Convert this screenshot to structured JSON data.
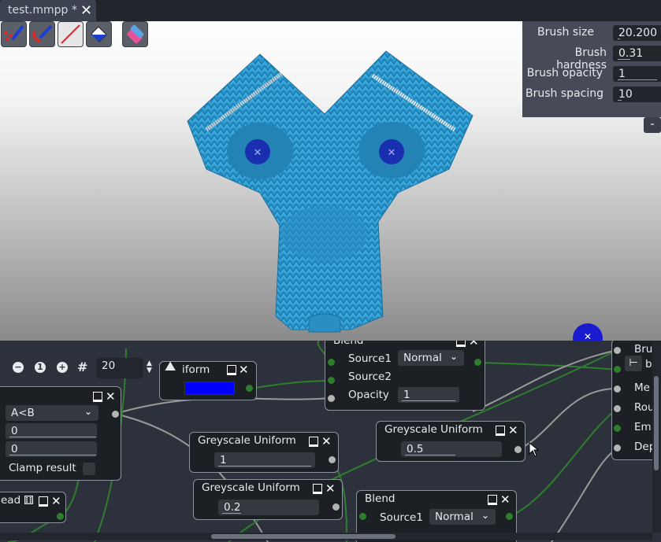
{
  "tab": {
    "title": "test.mmpp *",
    "close_icon": "close-icon"
  },
  "toolbar": {
    "tools": [
      {
        "name": "brush-dots-tool",
        "icon": "brush-dots-icon"
      },
      {
        "name": "brush-stroke-tool",
        "icon": "brush-stroke-icon"
      },
      {
        "name": "line-tool",
        "icon": "line-icon"
      },
      {
        "name": "fill-tool",
        "icon": "bucket-fill-icon"
      },
      {
        "name": "eraser-tool",
        "icon": "eraser-icon"
      }
    ]
  },
  "brush_params": {
    "rows": [
      {
        "label": "Brush size",
        "value": "20.200",
        "fill": 0.06
      },
      {
        "label": "Brush hardness",
        "value": "0.31",
        "fill": 0.31
      },
      {
        "label": "Brush opacity",
        "value": "1",
        "fill": 1.0
      },
      {
        "label": "Brush spacing",
        "value": "10",
        "fill": 0.1
      }
    ],
    "collapse_label": "-"
  },
  "graph_toolbar": {
    "zoom_value": "20"
  },
  "nodes": {
    "uniform": {
      "title": "iform",
      "color": "#0000ff"
    },
    "blend_top": {
      "title": "Blend",
      "source1_label": "Source1",
      "source1_value": "Normal",
      "source2_label": "Source2",
      "opacity_label": "Opacity",
      "opacity_value": "1"
    },
    "math": {
      "op": "A<B",
      "a": "0",
      "b": "0",
      "clamp_label": "Clamp result"
    },
    "grey1": {
      "title": "Greyscale Uniform",
      "value": "1"
    },
    "grey2": {
      "title": "Greyscale Uniform",
      "value": "0.2"
    },
    "grey3": {
      "title": "Greyscale Uniform",
      "value": "0.5"
    },
    "blend_bottom": {
      "title": "Blend",
      "source1_label": "Source1",
      "source1_value": "Normal"
    },
    "read": {
      "title": "ead"
    },
    "right_node": {
      "title": "Bru",
      "ports": [
        "b",
        "Me",
        "Rou",
        "Em",
        "Dep"
      ]
    }
  },
  "colors": {
    "accent_green": "#2f7d2f",
    "monkey_blue": "#2e9bd0",
    "viewport_top": "#ffffff",
    "panel": "#464b57",
    "node_bg": "#1c1f24"
  }
}
